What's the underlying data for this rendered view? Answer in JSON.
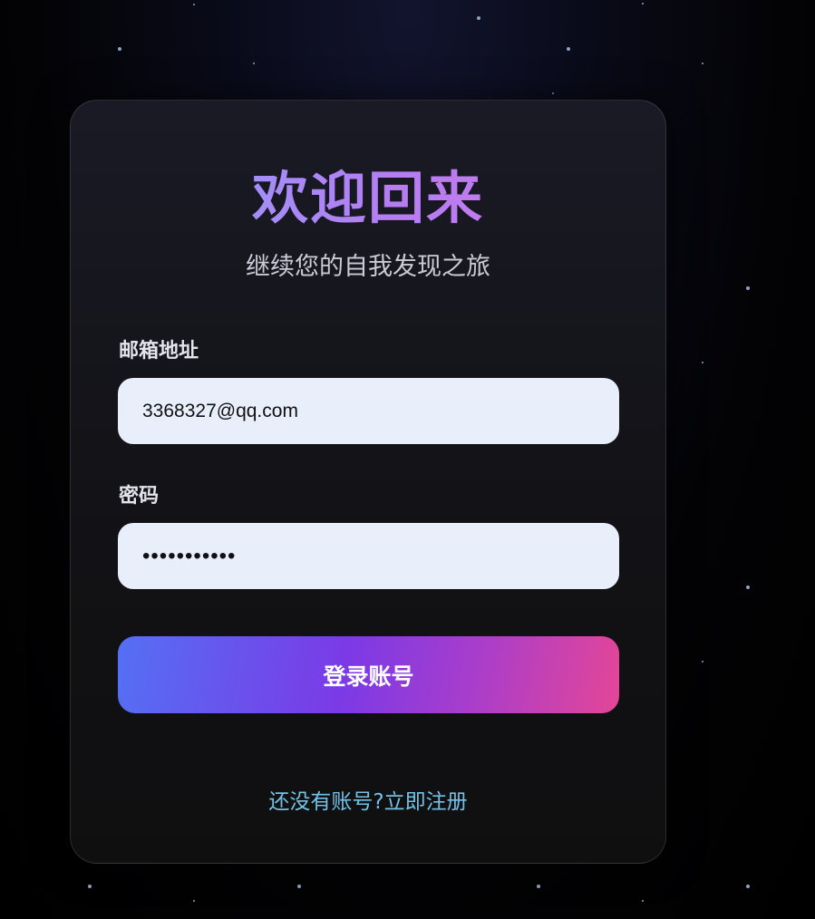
{
  "login": {
    "title": "欢迎回来",
    "subtitle": "继续您的自我发现之旅",
    "email": {
      "label": "邮箱地址",
      "value": "3368327@qq.com"
    },
    "password": {
      "label": "密码",
      "masked_value": "•••••••••••"
    },
    "submit_label": "登录账号",
    "signup_prompt": "还没有账号?",
    "signup_link": "立即注册"
  },
  "colors": {
    "title_gradient": [
      "#8ea2ff",
      "#b57df2",
      "#d87ae8"
    ],
    "button_gradient": [
      "#5470f4",
      "#7b3ae6",
      "#e44697"
    ],
    "input_background": "#e8effb",
    "link": "#74c1e8"
  }
}
